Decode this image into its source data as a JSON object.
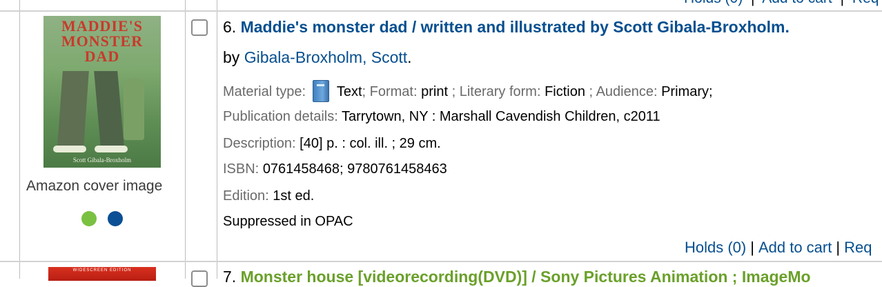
{
  "previous_row": {
    "holds_link": "Holds (0)",
    "separator": "|",
    "add_to_cart_link": "Add to cart",
    "request_link_partial": "Req"
  },
  "record": {
    "number": "6.",
    "title": "Maddie's monster dad / written and illustrated by Scott Gibala-Broxholm.",
    "by_label": "by",
    "author": "Gibala-Broxholm, Scott",
    "author_suffix": ".",
    "cover": {
      "caption": "Amazon cover image",
      "art_title_line1": "MADDIE'S",
      "art_title_line2": "MONSTER",
      "art_title_line3": "DAD",
      "art_byline": "Scott Gibala-Broxholm",
      "dots": [
        {
          "color": "#7ac142",
          "icon": "green-dot-icon"
        },
        {
          "color": "#0b4f94",
          "icon": "blue-dot-icon"
        }
      ]
    },
    "material_type": {
      "label": "Material type:",
      "icon": "book-icon",
      "value": "Text",
      "sep": ";"
    },
    "format": {
      "label": "Format:",
      "value": "print",
      "sep": ";"
    },
    "literary_form": {
      "label": "Literary form:",
      "value": "Fiction",
      "sep": ";"
    },
    "audience": {
      "label": "Audience:",
      "value": "Primary;"
    },
    "publication": {
      "label": "Publication details:",
      "value": "Tarrytown, NY : Marshall Cavendish Children, c2011"
    },
    "description": {
      "label": "Description:",
      "value": "[40] p. : col. ill. ; 29 cm."
    },
    "isbn": {
      "label": "ISBN:",
      "value": "0761458468; 9780761458463"
    },
    "edition": {
      "label": "Edition:",
      "value": "1st ed."
    },
    "suppressed": "Suppressed in OPAC",
    "links": {
      "holds": "Holds (0)",
      "separator": "|",
      "add_to_cart": "Add to cart",
      "request_partial": "Req"
    }
  },
  "next_record": {
    "number": "7.",
    "title_partial": "Monster house [videorecording(DVD)] / Sony Pictures Animation ; ImageMo",
    "cover_banner": "WIDESCREEN EDITION"
  },
  "colors": {
    "link": "#064f8f",
    "label_gray": "#6a6a6a",
    "next_title_green": "#6aa02a",
    "border": "#bdbdbd"
  }
}
